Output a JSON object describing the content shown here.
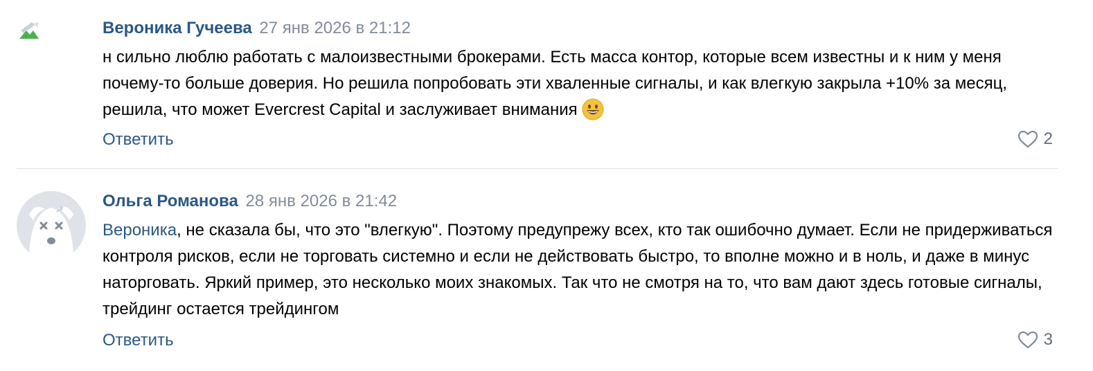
{
  "comments": [
    {
      "author": "Вероника Гучеева",
      "date": "27 янв 2026 в 21:12",
      "text": "н сильно люблю работать с малоизвестными брокерами. Есть масса контор, которые всем известны и к ним у меня почему-то больше доверия. Но решила попробовать эти хваленные сигналы, и как влегкую закрыла +10% за месяц, решила, что может Evercrest Capital и заслуживает внимания",
      "emoji": "grinning-face",
      "reply_label": "Ответить",
      "likes": "2"
    },
    {
      "author": "Ольга Романова",
      "date": "28 янв 2026 в 21:42",
      "mention": "Вероника",
      "text": ", не сказала бы, что это \"влегкую\". Поэтому предупрежу всех, кто так ошибочно думает. Если не придерживаться контроля рисков, если не торговать системно и если не действовать быстро, то вполне можно и в ноль, и даже в минус наторговать. Яркий пример, это несколько моих знакомых. Так что не смотря на то, что вам дают здесь готовые сигналы, трейдинг остается трейдингом",
      "reply_label": "Ответить",
      "likes": "3"
    }
  ],
  "colors": {
    "link": "#2a5885",
    "date": "#818c99",
    "likes": "#626d7a",
    "divider": "#dce1e6",
    "avatar_bg": "#dfe3e9"
  }
}
